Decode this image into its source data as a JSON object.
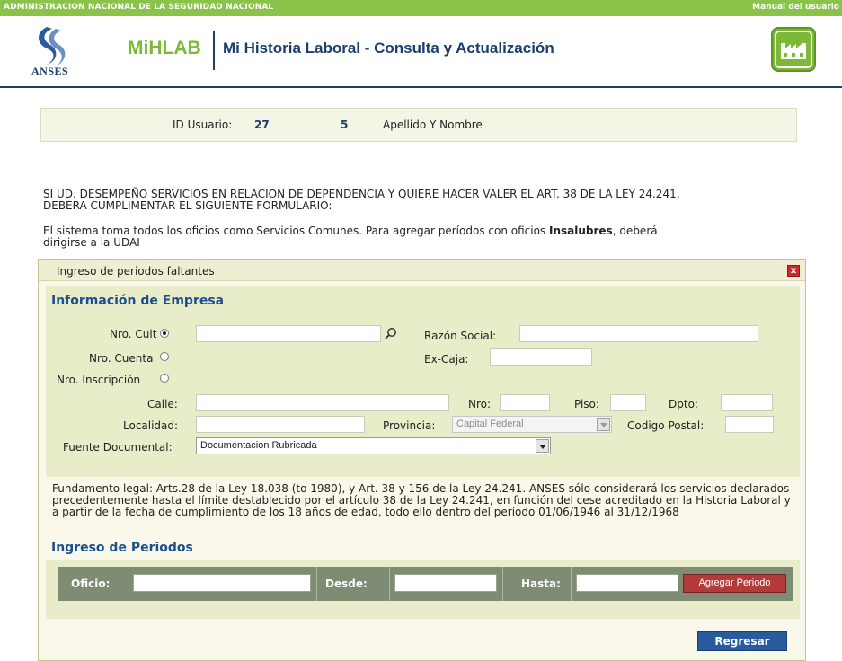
{
  "topbar": {
    "org": "ADMINISTRACION NACIONAL DE LA SEGURIDAD NACIONAL",
    "manual": "Manual del usuario"
  },
  "header": {
    "logo_text": "ANSES",
    "brand": "MiHLAB",
    "title": "Mi Historia Laboral - Consulta y Actualización"
  },
  "userbar": {
    "id_label": "ID Usuario:",
    "id_value_1": "27",
    "id_value_2": "5",
    "name_label": "Apellido Y Nombre"
  },
  "notice": {
    "line1": "SI UD. DESEMPEÑO SERVICIOS EN RELACION DE DEPENDENCIA Y QUIERE HACER VALER EL ART. 38 DE LA LEY 24.241,",
    "line2": "DEBERA CUMPLIMENTAR EL SIGUIENTE FORMULARIO:",
    "line3_pre": "El sistema toma todos los oficios como Servicios Comunes. Para agregar períodos con oficios ",
    "line3_bold": "Insalubres",
    "line3_post": ", deberá",
    "line4": "dirigirse a la UDAI"
  },
  "dialog": {
    "title": "Ingreso de periodos faltantes",
    "close": "x",
    "empresa": {
      "section_title": "Información de Empresa",
      "cuit_label": "Nro. Cuit",
      "cuenta_label": "Nro. Cuenta",
      "inscripcion_label": "Nro. Inscripción",
      "razon_label": "Razón Social:",
      "excaja_label": "Ex-Caja:",
      "calle_label": "Calle:",
      "nro_label": "Nro:",
      "piso_label": "Piso:",
      "dpto_label": "Dpto:",
      "localidad_label": "Localidad:",
      "provincia_label": "Provincia:",
      "provincia_value": "Capital Federal",
      "cp_label": "Codigo Postal:",
      "fuente_label": "Fuente Documental:",
      "fuente_value": "Documentacion Rubricada"
    },
    "legal": "Fundamento legal: Arts.28 de la Ley 18.038 (to 1980), y Art. 38 y 156 de la Ley 24.241. ANSES sólo considerará los servicios declarados precedentemente hasta el límite destablecido por el artículo 38 de la Ley 24.241, en función del cese acreditado en la Historia Laboral y a partir de la fecha de cumplimiento de los 18 años de edad, todo ello dentro del período 01/06/1946 al 31/12/1968",
    "periodos": {
      "section_title": "Ingreso de Periodos",
      "oficio_label": "Oficio:",
      "desde_label": "Desde:",
      "hasta_label": "Hasta:",
      "add_button": "Agregar Periodo"
    },
    "back_button": "Regresar"
  },
  "colors": {
    "topbar": "#8bc34a",
    "brand_green": "#7db839",
    "navy": "#1c3f6e",
    "section_blue": "#1c4f8e",
    "periods_bar": "#7e8c73",
    "add_button": "#b23a3a",
    "back_button": "#2a5a9e"
  },
  "icons": [
    "anses-logo-icon",
    "factory-icon",
    "search-icon",
    "close-icon",
    "chevron-down-icon"
  ]
}
